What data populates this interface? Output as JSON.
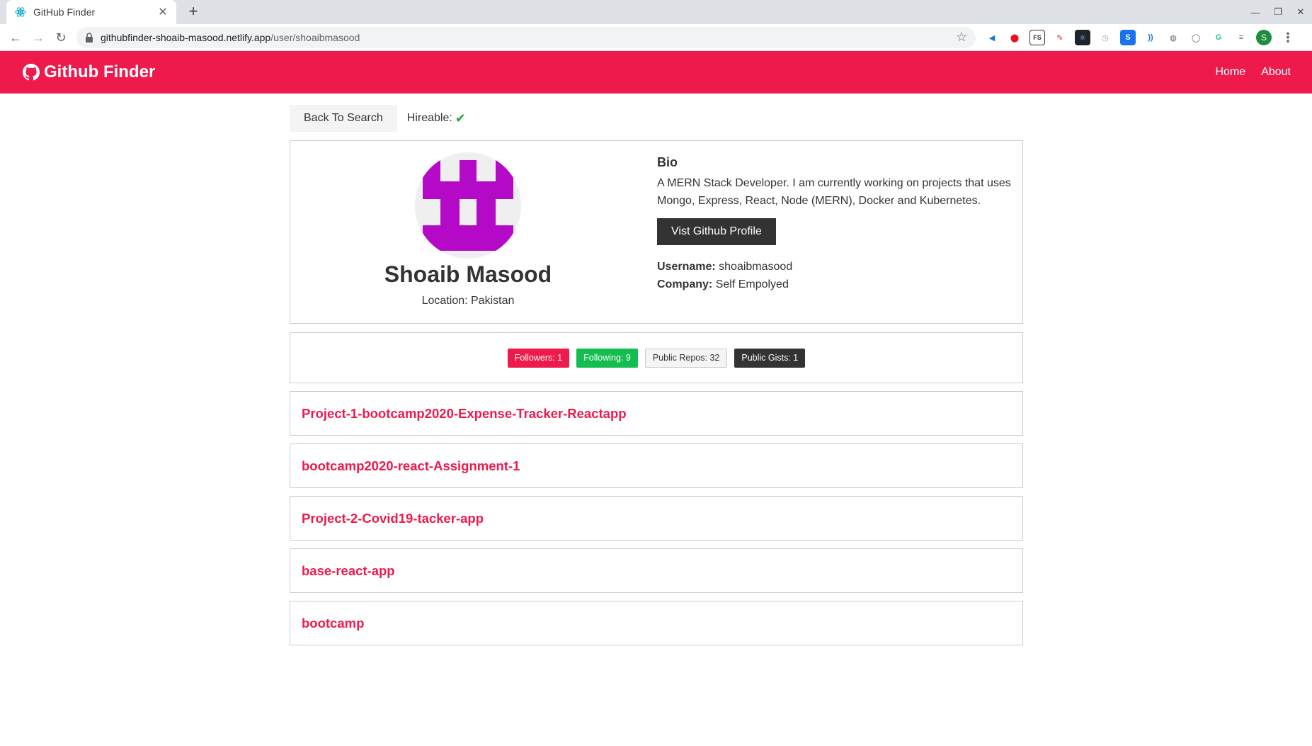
{
  "browser": {
    "tab_title": "GitHub Finder",
    "new_tab_symbol": "+",
    "url_host": "githubfinder-shoaib-masood.netlify.app",
    "url_path": "/user/shoaibmasood",
    "profile_initial": "S"
  },
  "navbar": {
    "brand": "Github Finder",
    "links": [
      "Home",
      "About"
    ]
  },
  "top": {
    "back_label": "Back To Search",
    "hireable_label": "Hireable:"
  },
  "profile": {
    "name": "Shoaib Masood",
    "location": "Location: Pakistan",
    "bio_heading": "Bio",
    "bio": "A MERN Stack Developer. I am currently working on projects that uses Mongo, Express, React, Node (MERN), Docker and Kubernetes.",
    "visit_label": "Vist Github Profile",
    "username_label": "Username:",
    "username": "shoaibmasood",
    "company_label": "Company:",
    "company": "Self Empolyed"
  },
  "badges": {
    "followers": "Followers: 1",
    "following": "Following: 9",
    "repos": "Public Repos: 32",
    "gists": "Public Gists: 1"
  },
  "repos": [
    "Project-1-bootcamp2020-Expense-Tracker-Reactapp",
    "bootcamp2020-react-Assignment-1",
    "Project-2-Covid19-tacker-app",
    "base-react-app",
    "bootcamp"
  ],
  "colors": {
    "primary": "#ee1a4b",
    "success": "#13bd4f",
    "dark": "#333333",
    "avatar": "#b40ac8"
  }
}
